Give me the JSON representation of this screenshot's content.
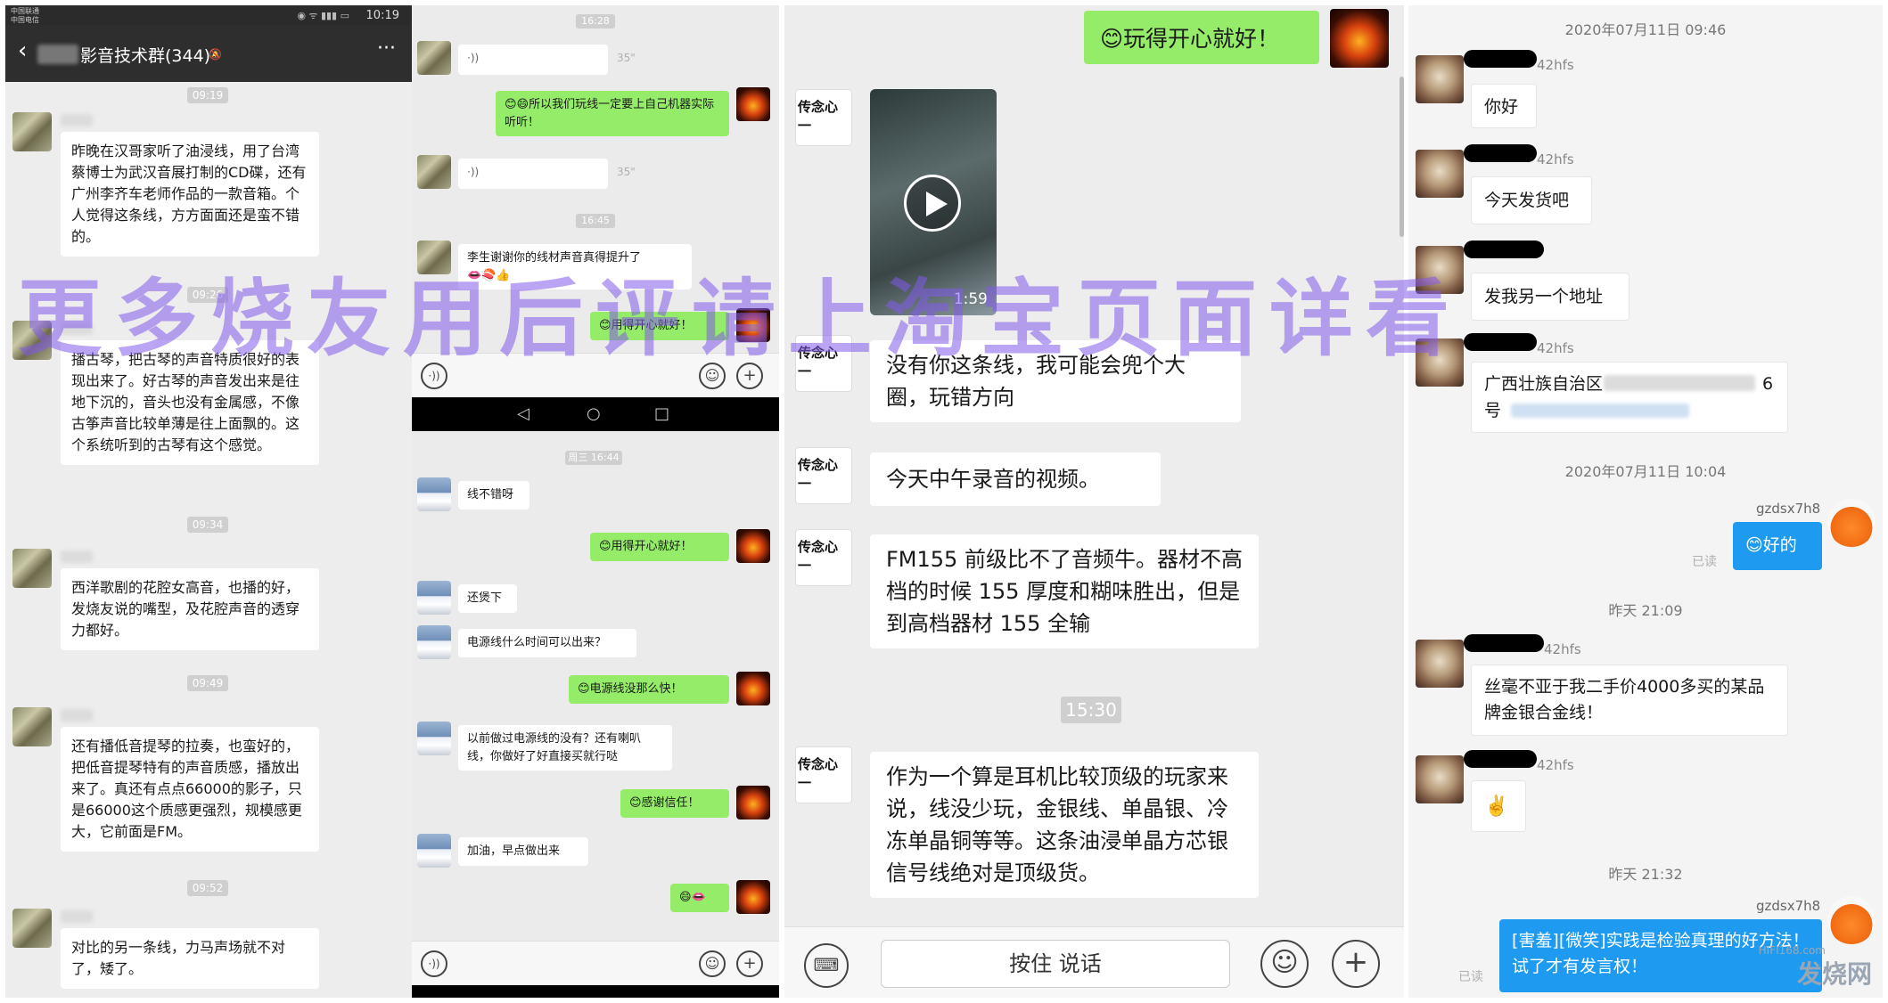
{
  "status_bar": {
    "carrier1": "中国联通",
    "carrier2": "中国电信",
    "time": "10:19"
  },
  "p1": {
    "title": "影音技术群(344)",
    "times": [
      "09:19",
      "09:26",
      "09:34",
      "09:49",
      "09:52"
    ],
    "messages": [
      "昨晚在汉哥家听了油浸线，用了台湾蔡博士为武汉音展打制的CD碟，还有广州李齐车老师作品的一款音箱。个人觉得这条线，方方面面还是蛮不错的。",
      "播古琴，把古琴的声音特质很好的表现出来了。好古琴的声音发出来是往地下沉的，音头也没有金属感，不像古筝声音比较单薄是往上面飘的。这个系统听到的古琴有这个感觉。",
      "西洋歌剧的花腔女高音，也播的好，发烧友说的嘴型，及花腔声音的透穿力都好。",
      "还有播低音提琴的拉奏，也蛮好的，把低音提琴特有的声音质感，播放出来了。真还有点点66000的影子，只是66000这个质感更强烈，规模感更大，它前面是FM。",
      "对比的另一条线，力马声场就不对了，矮了。"
    ]
  },
  "p2": {
    "times": [
      "16:28",
      "16:45",
      "周三 16:44"
    ],
    "voice1": "35\"",
    "voice2": "35\"",
    "m1": "😊😄所以我们玩线一定要上自己机器实际听听！",
    "m2": "李生谢谢你的线材声音真得提升了",
    "m2_emoji": "👄🍣👍",
    "m3": "😊用得开心就好！",
    "m4": "线不错呀",
    "m5": "😊用得开心就好！",
    "m6": "还煲下",
    "m7": "电源线什么时间可以出来？",
    "m8": "😊电源线没那么快！",
    "m9": "以前做过电源线的没有？还有喇叭线，你做好了好直接买就行哒",
    "m10": "😊感谢信任！",
    "m11": "加油，早点做出来",
    "m12": "😄👄"
  },
  "p3": {
    "m_top": "😊玩得开心就好！",
    "video_duration": "1:59",
    "m1": "没有你这条线，我可能会兜个大圈，玩错方向",
    "m2": "今天中午录音的视频。",
    "m3": "FM155 前级比不了音频牛。器材不高档的时候 155 厚度和糊味胜出，但是到高档器材 155 全输",
    "time": "15:30",
    "m4": "作为一个算是耳机比较顶级的玩家来说，线没少玩，金银线、单晶银、冷冻单晶铜等等。这条油浸单晶方芯银信号线绝对是顶级货。",
    "hold_to_talk": "按住 说话",
    "logo_text": "传念心一"
  },
  "p4": {
    "date1": "2020年07月11日 09:46",
    "user_suffix": "42hfs",
    "m1": "你好",
    "m2": "今天发货吧",
    "m3": "发我另一个地址",
    "m4a": "广西壮族自治区",
    "m4b": "6",
    "m4c": "号",
    "date2": "2020年07月11日 10:04",
    "me": "gzdsx7h8",
    "m5": "😊好的",
    "read": "已读",
    "date3": "昨天 21:09",
    "m6": "丝毫不亚于我二手价4000多买的某品牌金银合金线！",
    "m7": "✌️",
    "date4": "昨天 21:32",
    "m8": "[害羞][微笑]实践是检验真理的好方法！试了才有发言权！"
  },
  "watermark": "更多烧友用后评请上淘宝页面详看",
  "site": {
    "logo": "发烧网",
    "url": "HIFI168.com"
  }
}
